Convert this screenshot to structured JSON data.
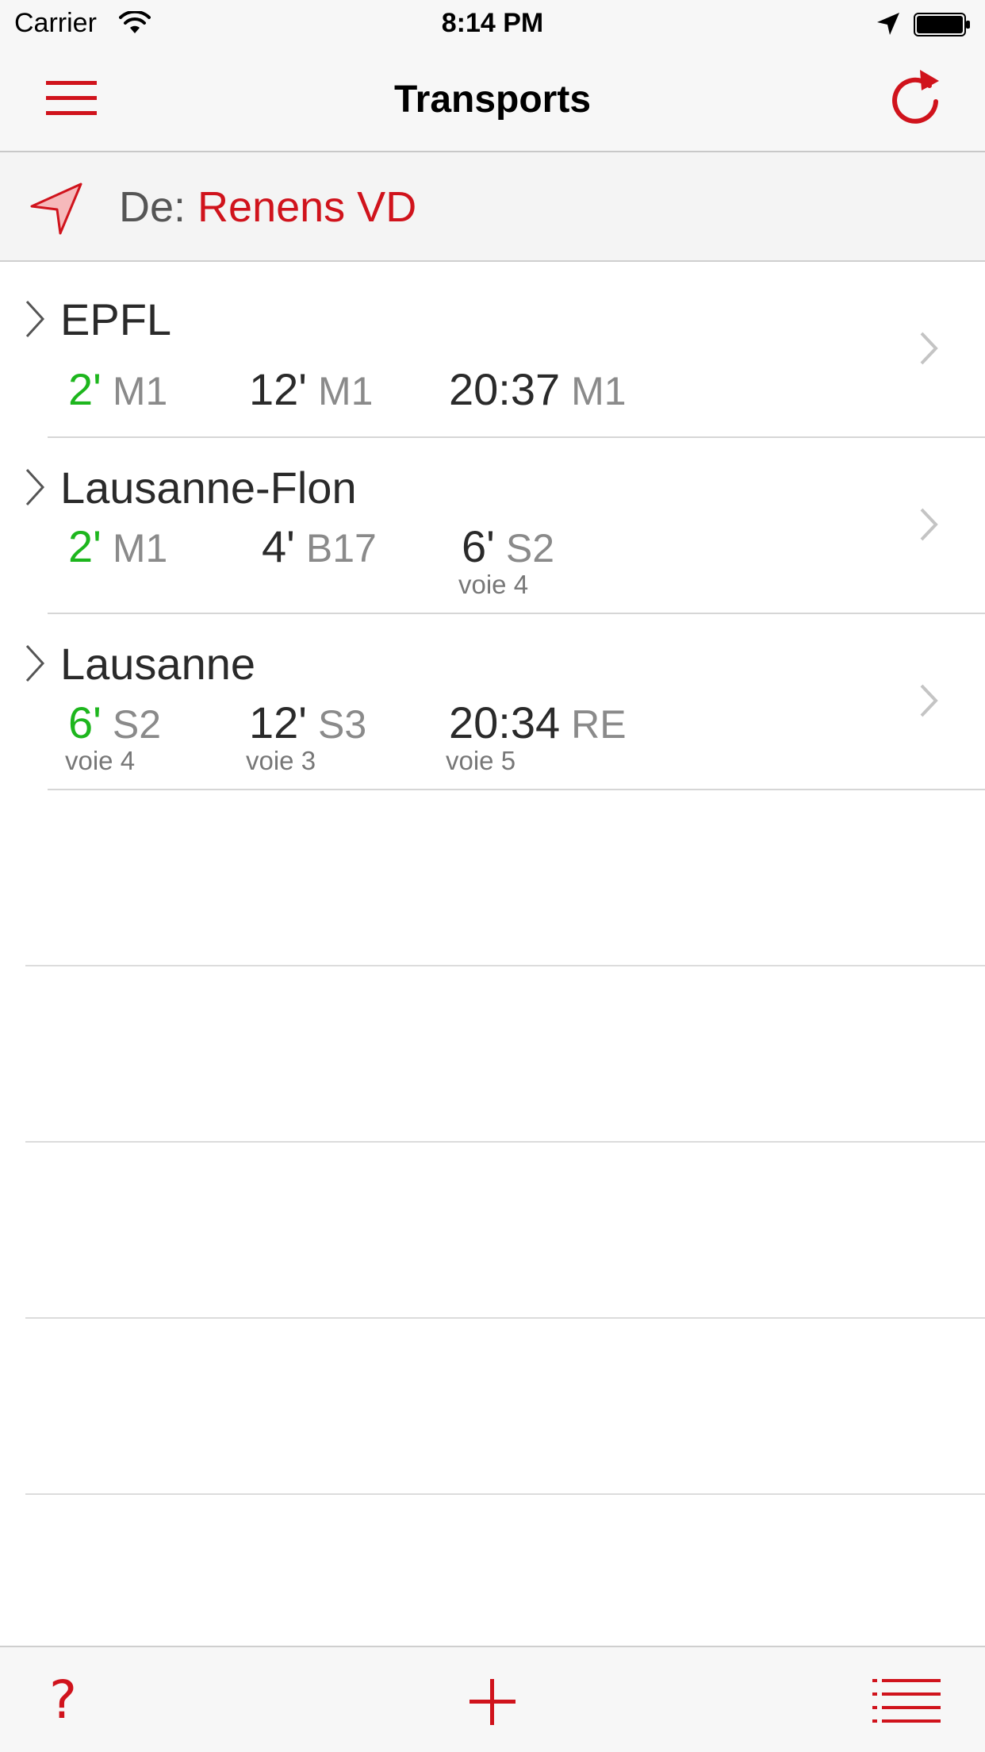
{
  "status_bar": {
    "carrier": "Carrier",
    "time": "8:14 PM"
  },
  "nav": {
    "title": "Transports"
  },
  "from": {
    "prefix": "De: ",
    "station": "Renens VD"
  },
  "destinations": [
    {
      "name": "EPFL",
      "departures": [
        {
          "time": "2'",
          "line": "M1",
          "platform": "",
          "soon": true
        },
        {
          "time": "12'",
          "line": "M1",
          "platform": "",
          "soon": false
        },
        {
          "time": "20:37",
          "line": "M1",
          "platform": "",
          "soon": false
        }
      ]
    },
    {
      "name": "Lausanne-Flon",
      "departures": [
        {
          "time": "2'",
          "line": "M1",
          "platform": "",
          "soon": true
        },
        {
          "time": "4'",
          "line": "B17",
          "platform": "",
          "soon": false
        },
        {
          "time": "6'",
          "line": "S2",
          "platform": "voie 4",
          "soon": false
        }
      ]
    },
    {
      "name": "Lausanne",
      "departures": [
        {
          "time": "6'",
          "line": "S2",
          "platform": "voie 4",
          "soon": true
        },
        {
          "time": "12'",
          "line": "S3",
          "platform": "voie 3",
          "soon": false
        },
        {
          "time": "20:34",
          "line": "RE",
          "platform": "voie 5",
          "soon": false
        }
      ]
    }
  ],
  "tab_bar": {
    "help_label": "?"
  },
  "icons": {
    "menu": "hamburger-menu-icon",
    "refresh": "refresh-icon",
    "location": "location-arrow-icon",
    "add": "plus-icon",
    "list": "list-icon",
    "expand": "chevron-right-icon"
  },
  "colors": {
    "accent": "#d0131c",
    "soon": "#1db61d",
    "line": "#8a8a8a"
  }
}
